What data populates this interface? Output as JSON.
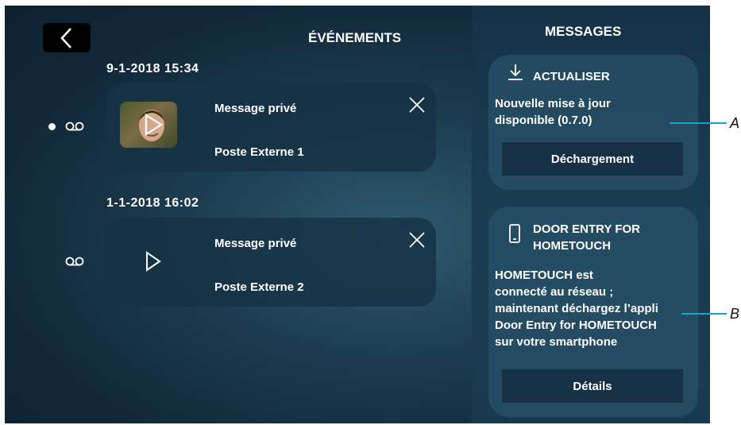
{
  "events": {
    "title": "ÉVÉNEMENTS",
    "items": [
      {
        "date": "9-1-2018  15:34",
        "message": "Message privé",
        "source": "Poste Externe 1",
        "unread": true
      },
      {
        "date": "1-1-2018  16:02",
        "message": "Message privé",
        "source": "Poste Externe 2",
        "unread": false
      }
    ]
  },
  "messages": {
    "title": "MESSAGES",
    "update": {
      "heading": "ACTUALISER",
      "line1": "Nouvelle mise à jour",
      "line2": "disponible (0.7.0)",
      "button": "Déchargement"
    },
    "door_entry": {
      "heading_line1": "DOOR ENTRY FOR",
      "heading_line2": "HOMETOUCH",
      "lines": [
        "HOMETOUCH est",
        "connecté au réseau ;",
        "maintenant déchargez l’appli",
        "Door Entry for HOMETOUCH",
        "sur votre smartphone"
      ],
      "button": "Détails"
    }
  },
  "callouts": {
    "a": "A",
    "b": "B"
  },
  "colors": {
    "accent": "#1aa4c9",
    "card": "#163244",
    "panel": "#153247"
  }
}
